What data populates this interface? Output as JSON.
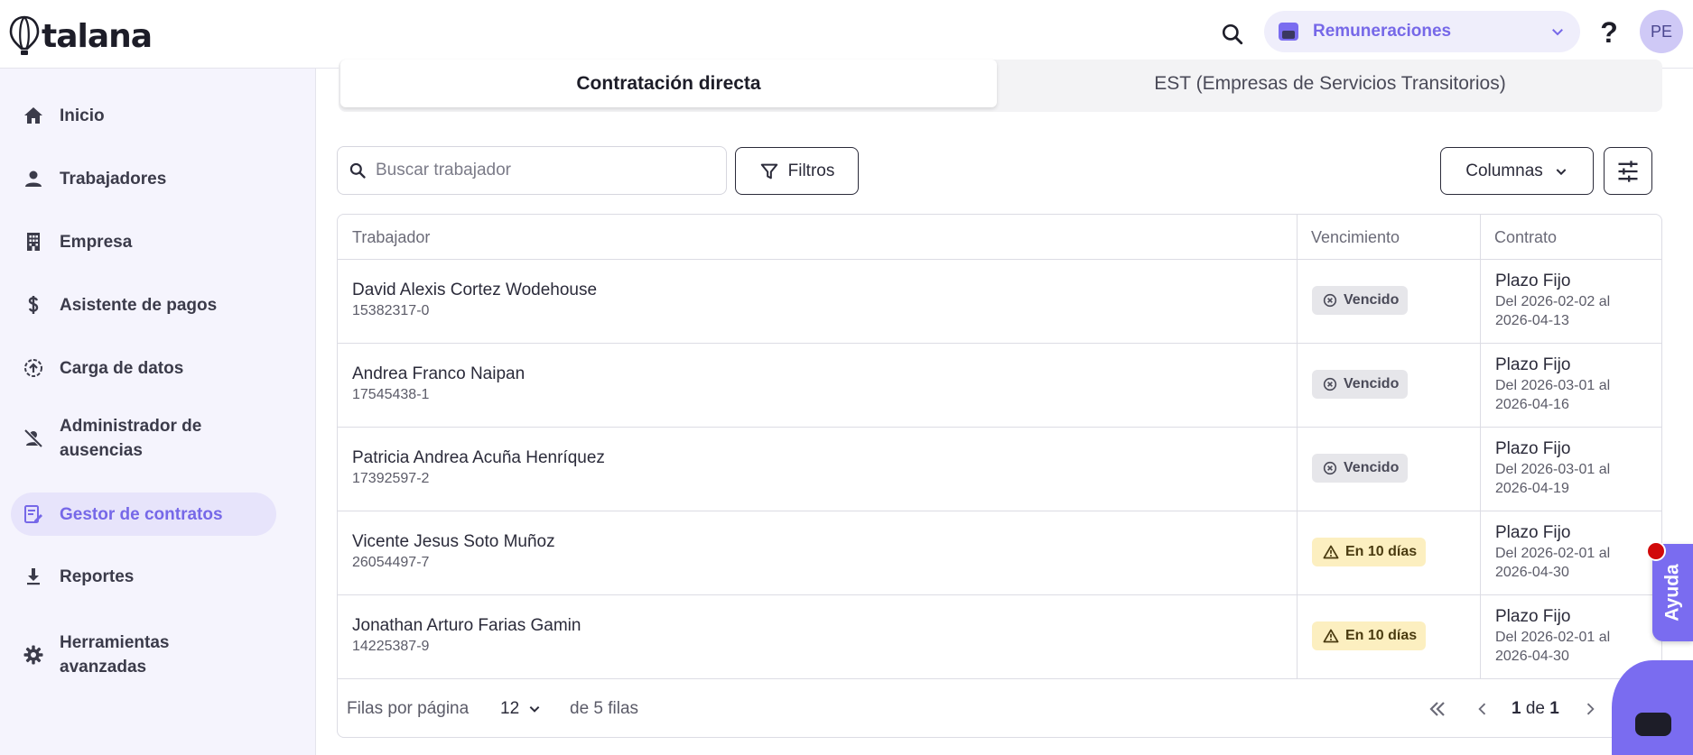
{
  "app": {
    "logo_text": "talana"
  },
  "header": {
    "module": "Remuneraciones",
    "help": "?",
    "avatar_initials": "PE"
  },
  "sidebar": {
    "items": [
      {
        "label": "Inicio",
        "icon": "home-icon"
      },
      {
        "label": "Trabajadores",
        "icon": "person-icon"
      },
      {
        "label": "Empresa",
        "icon": "building-icon"
      },
      {
        "label": "Asistente de pagos",
        "icon": "dollar-icon"
      },
      {
        "label": "Carga de datos",
        "icon": "upload-icon"
      },
      {
        "label": "Administrador de ausencias",
        "icon": "person-off-icon"
      },
      {
        "label": "Gestor de contratos",
        "icon": "contract-edit-icon",
        "active": true
      },
      {
        "label": "Reportes",
        "icon": "download-icon"
      },
      {
        "label": "Herramientas avanzadas",
        "icon": "gear-icon"
      }
    ]
  },
  "tabs": {
    "direct": "Contratación directa",
    "est": "EST (Empresas de Servicios Transitorios)"
  },
  "toolbar": {
    "search_placeholder": "Buscar trabajador",
    "filters_label": "Filtros",
    "columns_label": "Columnas"
  },
  "table": {
    "headers": {
      "worker": "Trabajador",
      "expiry": "Vencimiento",
      "contract": "Contrato"
    },
    "rows": [
      {
        "name": "David Alexis Cortez Wodehouse",
        "id": "15382317-0",
        "status": "Vencido",
        "status_type": "expired",
        "contract_type": "Plazo Fijo",
        "contract_dates": "Del 2026-02-02 al 2026-04-13"
      },
      {
        "name": "Andrea Franco Naipan",
        "id": "17545438-1",
        "status": "Vencido",
        "status_type": "expired",
        "contract_type": "Plazo Fijo",
        "contract_dates": "Del 2026-03-01 al 2026-04-16"
      },
      {
        "name": "Patricia Andrea Acuña Henríquez",
        "id": "17392597-2",
        "status": "Vencido",
        "status_type": "expired",
        "contract_type": "Plazo Fijo",
        "contract_dates": "Del 2026-03-01 al 2026-04-19"
      },
      {
        "name": "Vicente Jesus Soto Muñoz",
        "id": "26054497-7",
        "status": "En 10 días",
        "status_type": "soon",
        "contract_type": "Plazo Fijo",
        "contract_dates": "Del 2026-02-01 al 2026-04-30"
      },
      {
        "name": "Jonathan Arturo Farias Gamin",
        "id": "14225387-9",
        "status": "En 10 días",
        "status_type": "soon",
        "contract_type": "Plazo Fijo",
        "contract_dates": "Del 2026-02-01 al 2026-04-30"
      }
    ]
  },
  "pagination": {
    "rows_per_page_label": "Filas por página",
    "rows_per_page": "12",
    "rows_count": "de 5 filas",
    "current_page": "1",
    "page_sep": "de",
    "total_pages": "1"
  },
  "floating": {
    "help_label": "Ayuda"
  },
  "colors": {
    "accent": "#7a6cf0",
    "sidebar_bg": "#f5f4fd",
    "expired_badge": "#e6e6ea",
    "soon_badge": "#fcefc0",
    "notification": "#d10a0a"
  }
}
